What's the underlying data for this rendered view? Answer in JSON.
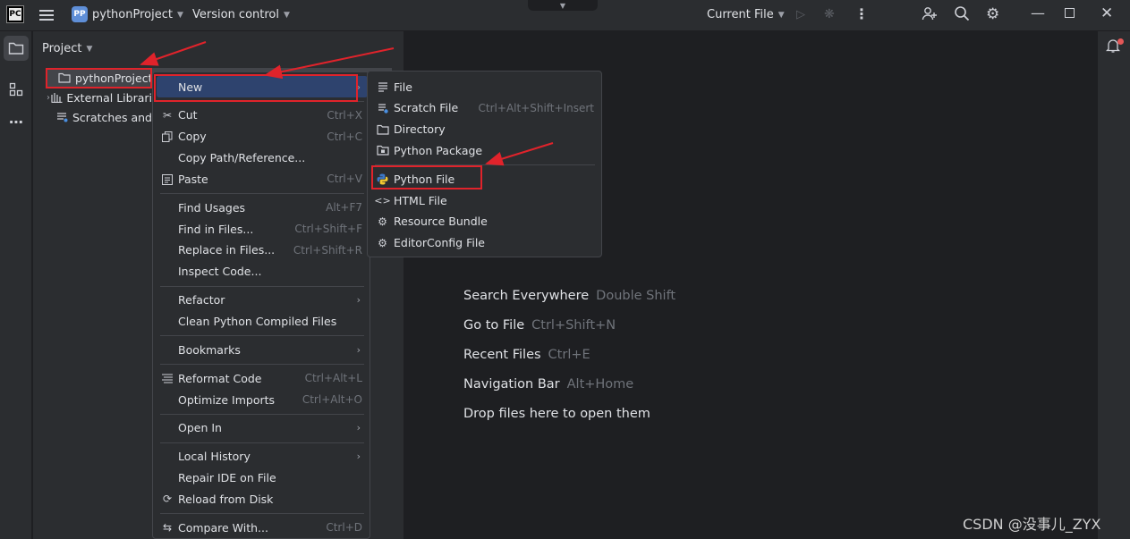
{
  "titlebar": {
    "logo": "PC",
    "project_badge": "PP",
    "project_name": "pythonProject",
    "vcs": "Version control",
    "run_config": "Current File",
    "icons": [
      "hamburger-menu-icon",
      "run-icon",
      "debug-icon",
      "more-vertical-icon",
      "add-user-icon",
      "search-icon",
      "gear-icon",
      "minimize-icon",
      "maximize-icon",
      "close-icon"
    ]
  },
  "project_panel": {
    "title": "Project",
    "tree": [
      {
        "label": "pythonProject",
        "icon": "folder-icon",
        "selected": true
      },
      {
        "label": "External Librari",
        "icon": "library-icon",
        "selected": false
      },
      {
        "label": "Scratches and",
        "icon": "scratches-icon",
        "selected": false
      }
    ]
  },
  "context_menu": [
    {
      "type": "item",
      "label": "New",
      "shortcut": "",
      "submenu": true,
      "highlighted": true,
      "icon": ""
    },
    {
      "type": "sep"
    },
    {
      "type": "item",
      "label": "Cut",
      "shortcut": "Ctrl+X",
      "icon": "scissors-icon"
    },
    {
      "type": "item",
      "label": "Copy",
      "shortcut": "Ctrl+C",
      "icon": "copy-icon"
    },
    {
      "type": "item",
      "label": "Copy Path/Reference...",
      "shortcut": "",
      "icon": ""
    },
    {
      "type": "item",
      "label": "Paste",
      "shortcut": "Ctrl+V",
      "icon": "paste-icon"
    },
    {
      "type": "sep"
    },
    {
      "type": "item",
      "label": "Find Usages",
      "shortcut": "Alt+F7",
      "icon": ""
    },
    {
      "type": "item",
      "label": "Find in Files...",
      "shortcut": "Ctrl+Shift+F",
      "icon": ""
    },
    {
      "type": "item",
      "label": "Replace in Files...",
      "shortcut": "Ctrl+Shift+R",
      "icon": ""
    },
    {
      "type": "item",
      "label": "Inspect Code...",
      "shortcut": "",
      "icon": ""
    },
    {
      "type": "sep"
    },
    {
      "type": "item",
      "label": "Refactor",
      "shortcut": "",
      "submenu": true,
      "icon": ""
    },
    {
      "type": "item",
      "label": "Clean Python Compiled Files",
      "shortcut": "",
      "icon": ""
    },
    {
      "type": "sep"
    },
    {
      "type": "item",
      "label": "Bookmarks",
      "shortcut": "",
      "submenu": true,
      "icon": ""
    },
    {
      "type": "sep"
    },
    {
      "type": "item",
      "label": "Reformat Code",
      "shortcut": "Ctrl+Alt+L",
      "icon": "reformat-icon"
    },
    {
      "type": "item",
      "label": "Optimize Imports",
      "shortcut": "Ctrl+Alt+O",
      "icon": ""
    },
    {
      "type": "sep"
    },
    {
      "type": "item",
      "label": "Open In",
      "shortcut": "",
      "submenu": true,
      "icon": ""
    },
    {
      "type": "sep"
    },
    {
      "type": "item",
      "label": "Local History",
      "shortcut": "",
      "submenu": true,
      "icon": ""
    },
    {
      "type": "item",
      "label": "Repair IDE on File",
      "shortcut": "",
      "icon": ""
    },
    {
      "type": "item",
      "label": "Reload from Disk",
      "shortcut": "",
      "icon": "reload-icon"
    },
    {
      "type": "sep"
    },
    {
      "type": "item",
      "label": "Compare With...",
      "shortcut": "Ctrl+D",
      "icon": "compare-icon"
    }
  ],
  "new_submenu": [
    {
      "type": "item",
      "label": "File",
      "shortcut": "",
      "icon": "file-icon"
    },
    {
      "type": "item",
      "label": "Scratch File",
      "shortcut": "Ctrl+Alt+Shift+Insert",
      "icon": "scratch-file-icon"
    },
    {
      "type": "item",
      "label": "Directory",
      "shortcut": "",
      "icon": "folder-icon"
    },
    {
      "type": "item",
      "label": "Python Package",
      "shortcut": "",
      "icon": "package-icon"
    },
    {
      "type": "sep"
    },
    {
      "type": "item",
      "label": "Python File",
      "shortcut": "",
      "icon": "python-icon"
    },
    {
      "type": "item",
      "label": "HTML File",
      "shortcut": "",
      "icon": "html-icon"
    },
    {
      "type": "item",
      "label": "Resource Bundle",
      "shortcut": "",
      "icon": "settings-icon"
    },
    {
      "type": "item",
      "label": "EditorConfig File",
      "shortcut": "",
      "icon": "settings-icon"
    }
  ],
  "editor_hints": [
    {
      "action": "Search Everywhere",
      "key": "Double Shift"
    },
    {
      "action": "Go to File",
      "key": "Ctrl+Shift+N"
    },
    {
      "action": "Recent Files",
      "key": "Ctrl+E"
    },
    {
      "action": "Navigation Bar",
      "key": "Alt+Home"
    },
    {
      "action": "Drop files here to open them",
      "key": ""
    }
  ],
  "watermark": "CSDN @没事儿_ZYX",
  "colors": {
    "bg": "#1e1f22",
    "panel": "#2b2d30",
    "highlight": "#2e436e",
    "annotation_red": "#e0232b"
  }
}
